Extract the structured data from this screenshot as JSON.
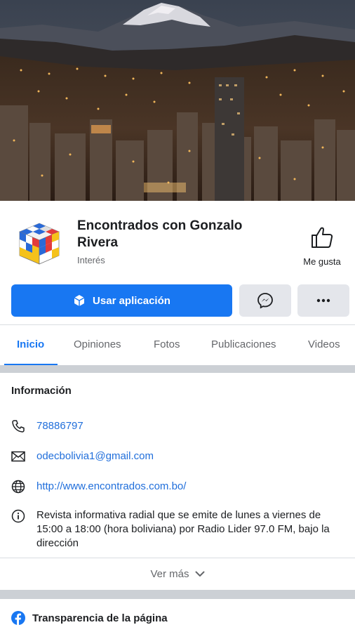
{
  "page": {
    "name": "Encontrados con Gonzalo Rivera",
    "category": "Interés",
    "like_label": "Me gusta"
  },
  "actions": {
    "primary_label": "Usar aplicación",
    "messenger_icon": "messenger-icon",
    "more_icon": "more-dots-icon"
  },
  "tabs": [
    {
      "label": "Inicio",
      "active": true
    },
    {
      "label": "Opiniones",
      "active": false
    },
    {
      "label": "Fotos",
      "active": false
    },
    {
      "label": "Publicaciones",
      "active": false
    },
    {
      "label": "Videos",
      "active": false
    }
  ],
  "info": {
    "title": "Información",
    "phone": "78886797",
    "email": "odecbolivia1@gmail.com",
    "website": "http://www.encontrados.com.bo/",
    "description": "Revista informativa radial que se emite de lunes a viernes de 15:00 a 18:00 (hora boliviana) por Radio Lider 97.0 FM, bajo la dirección"
  },
  "see_more_label": "Ver más",
  "transparency_label": "Transparencia de la página",
  "colors": {
    "accent": "#1877f2",
    "link": "#216fdb",
    "muted_text": "#65676b",
    "button_secondary": "#e4e6eb",
    "separator": "#ccd0d5"
  }
}
